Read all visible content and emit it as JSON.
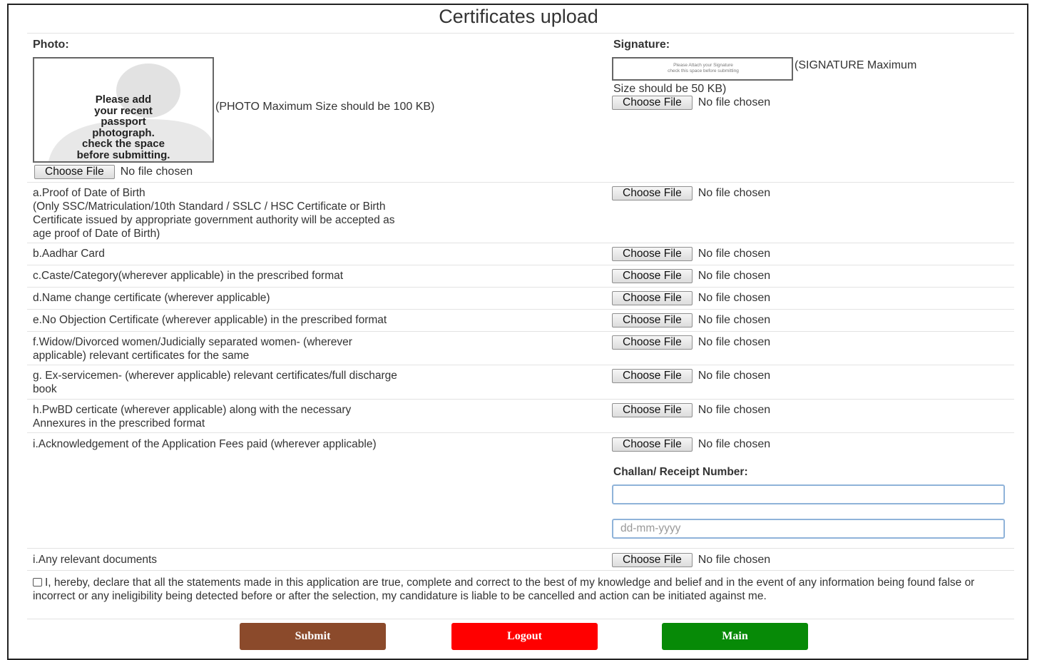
{
  "page": {
    "title": "Certificates upload"
  },
  "file_input": {
    "button_label": "Choose File",
    "status": "No file chosen"
  },
  "photo": {
    "label": "Photo:",
    "placeholder_lines": [
      "Please add",
      "your recent",
      "passport",
      "photograph.",
      "check the space",
      "before submitting."
    ],
    "size_note": "(PHOTO Maximum Size should be 100 KB)"
  },
  "signature": {
    "label": "Signature:",
    "placeholder_lines": [
      "Please Attach your Signature",
      "check this space before submitting"
    ],
    "size_note_line1": "(SIGNATURE Maximum",
    "size_note_line2": "Size should be 50 KB)"
  },
  "documents": [
    {
      "lines": [
        "a.Proof of Date of Birth",
        "(Only SSC/Matriculation/10th Standard / SSLC / HSC Certificate or Birth",
        "Certificate issued by appropriate government authority will be accepted as",
        "age proof of Date of Birth)"
      ]
    },
    {
      "lines": [
        "b.Aadhar Card"
      ]
    },
    {
      "lines": [
        "c.Caste/Category(wherever applicable) in the prescribed format"
      ]
    },
    {
      "lines": [
        "d.Name change certificate (wherever applicable)"
      ]
    },
    {
      "lines": [
        "e.No Objection Certificate (wherever applicable) in the prescribed format"
      ]
    },
    {
      "lines": [
        "f.Widow/Divorced women/Judicially separated women- (wherever",
        "applicable) relevant certificates for the same"
      ]
    },
    {
      "lines": [
        "g. Ex-servicemen- (wherever applicable) relevant certificates/full discharge",
        "book"
      ]
    },
    {
      "lines": [
        "h.PwBD certicate (wherever applicable) along with the necessary",
        "Annexures in the prescribed format"
      ]
    },
    {
      "lines": [
        "i.Acknowledgement of the Application Fees paid (wherever applicable)"
      ]
    },
    {
      "lines": [
        "i.Any relevant documents"
      ]
    }
  ],
  "challan": {
    "label": "Challan/ Receipt Number:",
    "value": "",
    "date_placeholder": "dd-mm-yyyy"
  },
  "declaration": {
    "checked": false,
    "text": "I, hereby, declare that all the statements made in this application are true, complete and correct to the best of my knowledge and belief and in the event of any information being found false or incorrect or any ineligibility being detected before or after the selection, my candidature is liable to be cancelled and action can be initiated against me."
  },
  "actions": {
    "submit": {
      "label": "Submit",
      "color": "#8b4a2b"
    },
    "logout": {
      "label": "Logout",
      "color": "#ff0000"
    },
    "main": {
      "label": "Main",
      "color": "#078a07"
    }
  }
}
